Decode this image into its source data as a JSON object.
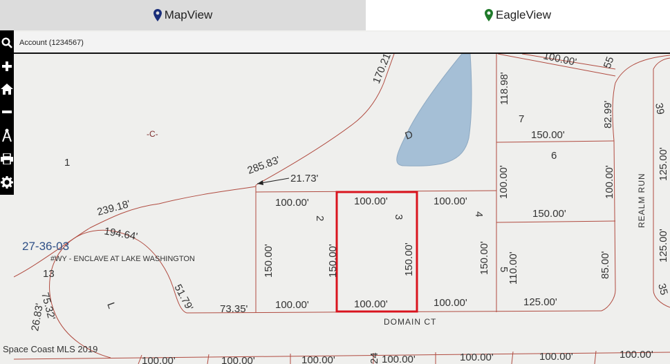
{
  "tabs": [
    {
      "label": "MapView",
      "color": "#1a2e7a"
    },
    {
      "label": "EagleView",
      "color": "#1f7a2a"
    }
  ],
  "toolbar": [
    "search-icon",
    "zoom-in-icon",
    "home-icon",
    "zoom-out-icon",
    "measure-icon",
    "print-icon",
    "settings-icon"
  ],
  "account": "Account (1234567)",
  "map": {
    "section": "27-36-03",
    "subdivision": "#WY - ENCLAVE AT LAKE WASHINGTON",
    "tract_c": "-C-",
    "tract_d": "D",
    "tract_l": "L",
    "lot_1": "1",
    "lot_2": "2",
    "lot_3": "3",
    "lot_4": "4",
    "lot_5": "5",
    "lot_6": "6",
    "lot_7": "7",
    "street_domain": "DOMAIN CT",
    "street_realm": "REALM RUN",
    "dims": {
      "d170": "170.21",
      "d285": "285.83'",
      "d21": "21.73'",
      "d239": "239.18'",
      "d194": "194.64'",
      "d13": "13",
      "d75": "75.32'",
      "d26": "26.83'",
      "d51": "51.79'",
      "d73": "73.35'",
      "top2": "100.00'",
      "top3": "100.00'",
      "top4": "100.00'",
      "bot2": "100.00'",
      "bot3": "100.00'",
      "bot4": "100.00'",
      "bot5": "125.00'",
      "side150a": "150.00'",
      "side150b": "150.00'",
      "side150c": "150.00'",
      "side150d": "150.00'",
      "d118": "118.98'",
      "d100v": "100.00'",
      "d150h7": "150.00'",
      "d150h5": "150.00'",
      "d82": "82.99'",
      "d100r": "100.00'",
      "d110": "110.00'",
      "d85": "85.00'",
      "d100top": "100.00'",
      "d55": "55",
      "d39": "39",
      "d125r1": "125.00'",
      "d125r2": "125.00'",
      "d35": "35",
      "b1": "100.00'",
      "b2": "100.00'",
      "b3": "100.00'",
      "b4": "100.00'",
      "b5": "100.00'",
      "b6": "100.00'",
      "b7": "100.00'",
      "b24": "24"
    }
  },
  "copyright": "Space Coast MLS 2019",
  "colors": {
    "parcel": "#b04a3f",
    "lake": "#a5bfd6",
    "highlight": "#d9141e"
  }
}
